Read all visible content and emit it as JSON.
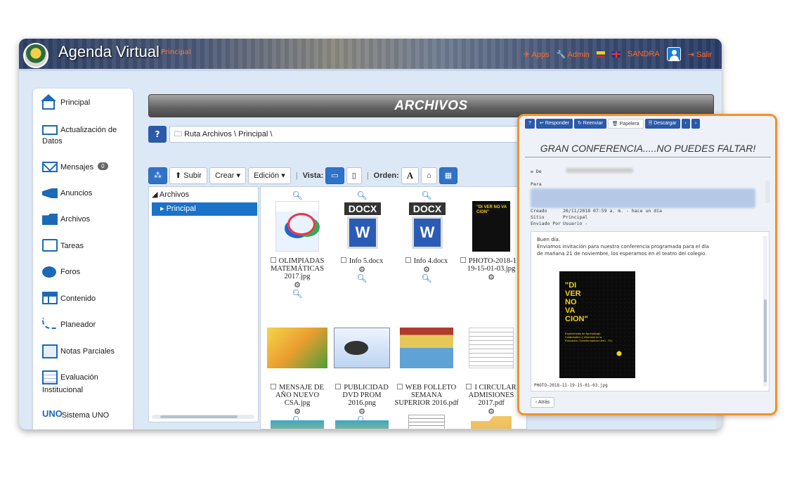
{
  "app": {
    "title": "Agenda Virtual",
    "subtitle": "Principal",
    "apps_label": "Apps",
    "admin_label": "Admin",
    "user_name": "SANDRA",
    "logout_label": "Salir"
  },
  "sidebar": {
    "items": [
      {
        "label": "Principal",
        "icon": "home-icon"
      },
      {
        "label": "Actualización de",
        "label2": "Datos",
        "icon": "id-card-icon"
      },
      {
        "label": "Mensajes",
        "badge": "0",
        "icon": "mail-icon"
      },
      {
        "label": "Anuncios",
        "icon": "megaphone-icon"
      },
      {
        "label": "Archivos",
        "icon": "folder-icon"
      },
      {
        "label": "Tareas",
        "icon": "tasks-icon"
      },
      {
        "label": "Foros",
        "icon": "chat-icon"
      },
      {
        "label": "Contenido",
        "icon": "content-icon"
      },
      {
        "label": "Planeador",
        "icon": "planner-icon"
      },
      {
        "label": "Notas Parciales",
        "icon": "notes-icon"
      },
      {
        "label": "Evaluación",
        "label2": "Institucional",
        "icon": "evaluation-icon"
      },
      {
        "label": "Sistema UNO",
        "icon": "uno-icon"
      }
    ]
  },
  "main": {
    "title": "ARCHIVOS",
    "path": "Ruta  Archivos \\ Principal \\",
    "toolbar": {
      "upload": "Subir",
      "create": "Crear",
      "edit": "Edición",
      "view_label": "Vista:",
      "order_label": "Orden:",
      "order_alpha": "A"
    },
    "tree": {
      "root": "Archivos",
      "selected": "Principal"
    },
    "files": [
      {
        "name": "OLIMPIADAS MATEMÁTICAS 2017.jpg"
      },
      {
        "name": "Info 5.docx"
      },
      {
        "name": "Info 4.docx"
      },
      {
        "name": "PHOTO-2018-11-19-15-01-03.jpg"
      },
      {
        "name": "MENSAJE DE AÑO NUEVO CSA.jpg"
      },
      {
        "name": "PUBLICIDAD DVD PROM 2016.png"
      },
      {
        "name": "WEB FOLLETO SEMANA SUPERIOR 2016.pdf"
      },
      {
        "name": "I CIRCULAR ADMISIONES 2017.pdf"
      }
    ],
    "docx_label": "DOCX",
    "word_letter": "W",
    "poster_text": "\"DI VER NO VA CION\""
  },
  "message": {
    "toolbar": {
      "reply": "Responder",
      "forward": "Reenviar",
      "trash": "Papelera",
      "download": "Descargar"
    },
    "subject": "GRAN CONFERENCIA.....NO PUEDES FALTAR!",
    "from_label": "De",
    "to_label": "Para",
    "created_label": "Creado",
    "created_value": "20/11/2018  07:59 a. m.  -  hace un día",
    "site_label": "Sitio",
    "site_value": "Principal",
    "sent_by_label": "Enviado Por",
    "sent_by_value": "Usuario -",
    "body_line1": "Buen día.",
    "body_line2": "Enviamos invitación para nuestra conferencia programada para el día",
    "body_line3": "de mañana 21 de noviembre, los esperamos en el teatro del colegio.",
    "poster_title": "\"DI\nVER\nNO\nVA\nCION\"",
    "poster_sub": "Experiencias de Aprendizaje Colaborativo y Vivencial en la Educación Transformadora UNO - FLI",
    "attachment": "PHOTO-2018-11-19-15-01-03.jpg",
    "back_label": "Atrás"
  },
  "colors": {
    "accent_blue": "#1a73c8",
    "panel_border": "#f0922d",
    "header_orange": "#ff6a28"
  }
}
